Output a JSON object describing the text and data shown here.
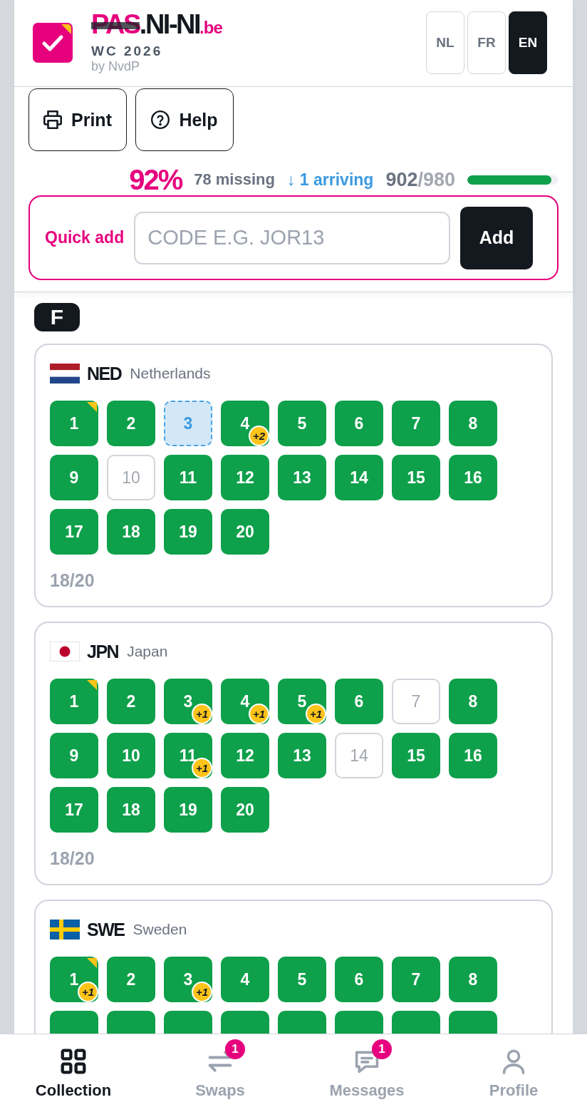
{
  "header": {
    "logo": {
      "parts": [
        {
          "text": "PAS",
          "kind": "struck"
        },
        {
          "text": ".NI-NI",
          "kind": "plain"
        },
        {
          "text": ".be",
          "kind": "suffix"
        }
      ],
      "edition": "WC 2026",
      "byline": "by NvdP"
    },
    "languages": [
      {
        "label": "NL",
        "selected": false
      },
      {
        "label": "FR",
        "selected": false
      },
      {
        "label": "EN",
        "selected": true
      }
    ]
  },
  "toolbar": [
    {
      "label": "Print"
    },
    {
      "label": "Help"
    }
  ],
  "stats": {
    "percent": "92%",
    "missing": "78 missing",
    "arriving": "↓ 1 arriving",
    "owned": "902",
    "total": "/980",
    "level": 0.92
  },
  "quick_add": {
    "label": "Quick add",
    "placeholder": "CODE E.G. JOR13",
    "button": "Add"
  },
  "groups": [
    {
      "label": "F",
      "teams": [
        {
          "code": "NED",
          "name": "Netherlands",
          "count": "18/20",
          "stickers": [
            {
              "number": "1",
              "kind": "owned",
              "corner": true
            },
            {
              "number": "2",
              "kind": "owned",
              "corner": false
            },
            {
              "number": "3",
              "kind": "arriving",
              "corner": false
            },
            {
              "number": "4",
              "kind": "owned",
              "corner": false,
              "extra": "+2"
            },
            {
              "number": "5",
              "kind": "owned",
              "corner": false
            },
            {
              "number": "6",
              "kind": "owned",
              "corner": false
            },
            {
              "number": "7",
              "kind": "owned",
              "corner": false
            },
            {
              "number": "8",
              "kind": "owned",
              "corner": false
            },
            {
              "number": "9",
              "kind": "owned",
              "corner": false
            },
            {
              "number": "10",
              "kind": "missing",
              "corner": false
            },
            {
              "number": "11",
              "kind": "owned",
              "corner": false
            },
            {
              "number": "12",
              "kind": "owned",
              "corner": false
            },
            {
              "number": "13",
              "kind": "owned",
              "corner": false
            },
            {
              "number": "14",
              "kind": "owned",
              "corner": false
            },
            {
              "number": "15",
              "kind": "owned",
              "corner": false
            },
            {
              "number": "16",
              "kind": "owned",
              "corner": false
            },
            {
              "number": "17",
              "kind": "owned",
              "corner": false
            },
            {
              "number": "18",
              "kind": "owned",
              "corner": false
            },
            {
              "number": "19",
              "kind": "owned",
              "corner": false
            },
            {
              "number": "20",
              "kind": "owned",
              "corner": false
            }
          ]
        },
        {
          "code": "JPN",
          "name": "Japan",
          "count": "18/20",
          "stickers": [
            {
              "number": "1",
              "kind": "owned",
              "corner": true
            },
            {
              "number": "2",
              "kind": "owned",
              "corner": false
            },
            {
              "number": "3",
              "kind": "owned",
              "corner": false,
              "extra": "+1"
            },
            {
              "number": "4",
              "kind": "owned",
              "corner": false,
              "extra": "+1"
            },
            {
              "number": "5",
              "kind": "owned",
              "corner": false,
              "extra": "+1"
            },
            {
              "number": "6",
              "kind": "owned",
              "corner": false
            },
            {
              "number": "7",
              "kind": "missing",
              "corner": false
            },
            {
              "number": "8",
              "kind": "owned",
              "corner": false
            },
            {
              "number": "9",
              "kind": "owned",
              "corner": false
            },
            {
              "number": "10",
              "kind": "owned",
              "corner": false
            },
            {
              "number": "11",
              "kind": "owned",
              "corner": false,
              "extra": "+1"
            },
            {
              "number": "12",
              "kind": "owned",
              "corner": false
            },
            {
              "number": "13",
              "kind": "owned",
              "corner": false
            },
            {
              "number": "14",
              "kind": "missing",
              "corner": false
            },
            {
              "number": "15",
              "kind": "owned",
              "corner": false
            },
            {
              "number": "16",
              "kind": "owned",
              "corner": false
            },
            {
              "number": "17",
              "kind": "owned",
              "corner": false
            },
            {
              "number": "18",
              "kind": "owned",
              "corner": false
            },
            {
              "number": "19",
              "kind": "owned",
              "corner": false
            },
            {
              "number": "20",
              "kind": "owned",
              "corner": false
            }
          ]
        },
        {
          "code": "SWE",
          "name": "Sweden",
          "stickers": [
            {
              "number": "1",
              "kind": "owned",
              "corner": true,
              "extra": "+1"
            },
            {
              "number": "2",
              "kind": "owned",
              "corner": false
            },
            {
              "number": "3",
              "kind": "owned",
              "corner": false,
              "extra": "+1"
            },
            {
              "number": "4",
              "kind": "owned",
              "corner": false
            },
            {
              "number": "5",
              "kind": "owned",
              "corner": false
            },
            {
              "number": "6",
              "kind": "owned",
              "corner": false
            },
            {
              "number": "7",
              "kind": "owned",
              "corner": false
            },
            {
              "number": "8",
              "kind": "owned",
              "corner": false
            },
            {
              "kind": "owned",
              "corner": false
            },
            {
              "kind": "owned",
              "corner": false
            },
            {
              "kind": "owned",
              "corner": false
            },
            {
              "kind": "owned",
              "corner": false
            },
            {
              "kind": "owned",
              "corner": false
            },
            {
              "kind": "owned",
              "corner": false
            },
            {
              "kind": "owned",
              "corner": false
            },
            {
              "kind": "owned",
              "corner": false
            }
          ]
        }
      ]
    }
  ],
  "nav": [
    {
      "label": "Collection",
      "selected": true
    },
    {
      "label": "Swaps",
      "selected": false,
      "badge": "1"
    },
    {
      "label": "Messages",
      "selected": false,
      "badge": "1"
    },
    {
      "label": "Profile",
      "selected": false
    }
  ]
}
